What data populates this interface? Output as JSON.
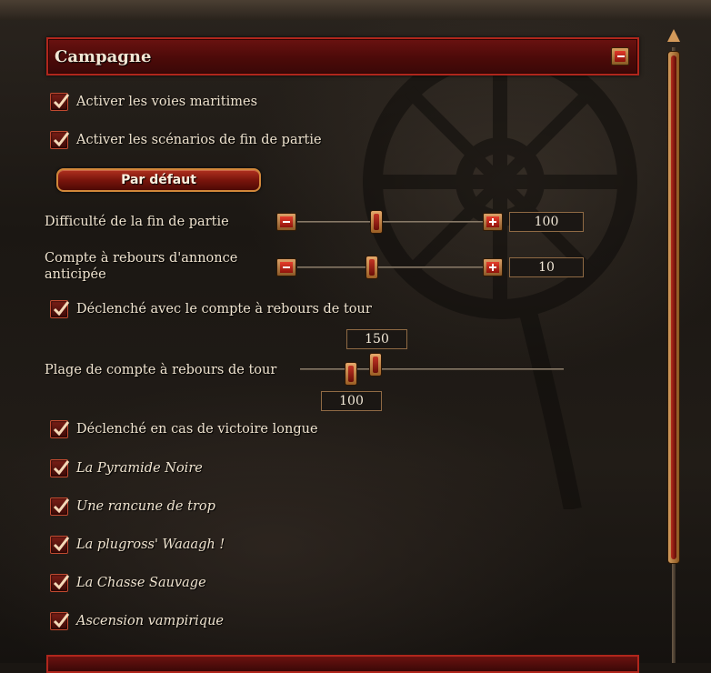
{
  "section": {
    "title": "Campagne"
  },
  "checkboxes_top": [
    {
      "label": "Activer les voies maritimes",
      "checked": true
    },
    {
      "label": "Activer les scénarios de fin de partie",
      "checked": true
    }
  ],
  "default_button": {
    "label": "Par défaut"
  },
  "sliders": [
    {
      "label": "Difficulté de la fin de partie",
      "value": "100"
    },
    {
      "label_line1": "Compte à rebours d'annonce",
      "label_line2": "anticipée",
      "value": "10"
    }
  ],
  "turn_countdown_checkbox": {
    "label": "Déclenché avec le compte à rebours de tour",
    "checked": true
  },
  "range_slider": {
    "label": "Plage de compte à rebours de tour",
    "max_value": "150",
    "min_value": "100"
  },
  "victory_checkbox": {
    "label": "Déclenché en cas de victoire longue",
    "checked": true
  },
  "scenarios": [
    {
      "label": "La Pyramide Noire",
      "checked": true
    },
    {
      "label": "Une rancune de trop",
      "checked": true
    },
    {
      "label": "La plugross' Waaagh !",
      "checked": true
    },
    {
      "label": "La Chasse Sauvage",
      "checked": true
    },
    {
      "label": "Ascension vampirique",
      "checked": true
    }
  ],
  "icons": {
    "collapse": "minus-icon",
    "decrease": "minus-icon",
    "increase": "plus-icon",
    "check": "checkmark-icon",
    "scroll_up": "arrow-up-icon"
  },
  "colors": {
    "accent_red": "#b0261c",
    "gold": "#d49a5a",
    "text": "#efe3cf"
  }
}
